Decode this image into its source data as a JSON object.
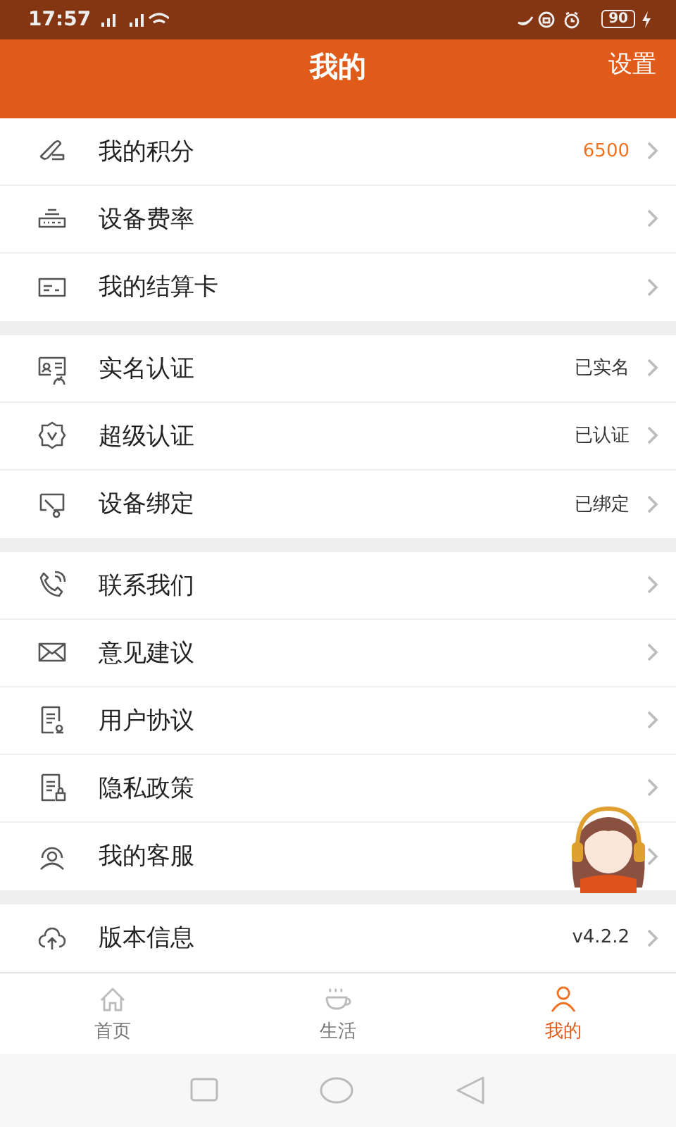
{
  "status_bar": {
    "time": "17:57",
    "battery": "90"
  },
  "header": {
    "title": "我的",
    "action": "设置"
  },
  "groups": [
    {
      "items": [
        {
          "label": "我的积分",
          "value": "6500",
          "color": "#f07020"
        },
        {
          "label": "设备费率"
        },
        {
          "label": "我的结算卡"
        }
      ]
    },
    {
      "items": [
        {
          "label": "实名认证",
          "value": "已实名",
          "color": "#333333"
        },
        {
          "label": "超级认证",
          "value": "已认证",
          "color": "#333333"
        },
        {
          "label": "设备绑定",
          "value": "已绑定",
          "color": "#333333"
        }
      ]
    },
    {
      "items": [
        {
          "label": "联系我们"
        },
        {
          "label": "意见建议"
        },
        {
          "label": "用户协议"
        },
        {
          "label": "隐私政策"
        },
        {
          "label": "我的客服"
        }
      ]
    },
    {
      "items": [
        {
          "label": "版本信息",
          "value": "v4.2.2",
          "color": "#333333"
        }
      ]
    }
  ],
  "tabs": [
    {
      "label": "首页",
      "selected": false
    },
    {
      "label": "生活",
      "selected": false
    },
    {
      "label": "我的",
      "selected": true
    }
  ]
}
